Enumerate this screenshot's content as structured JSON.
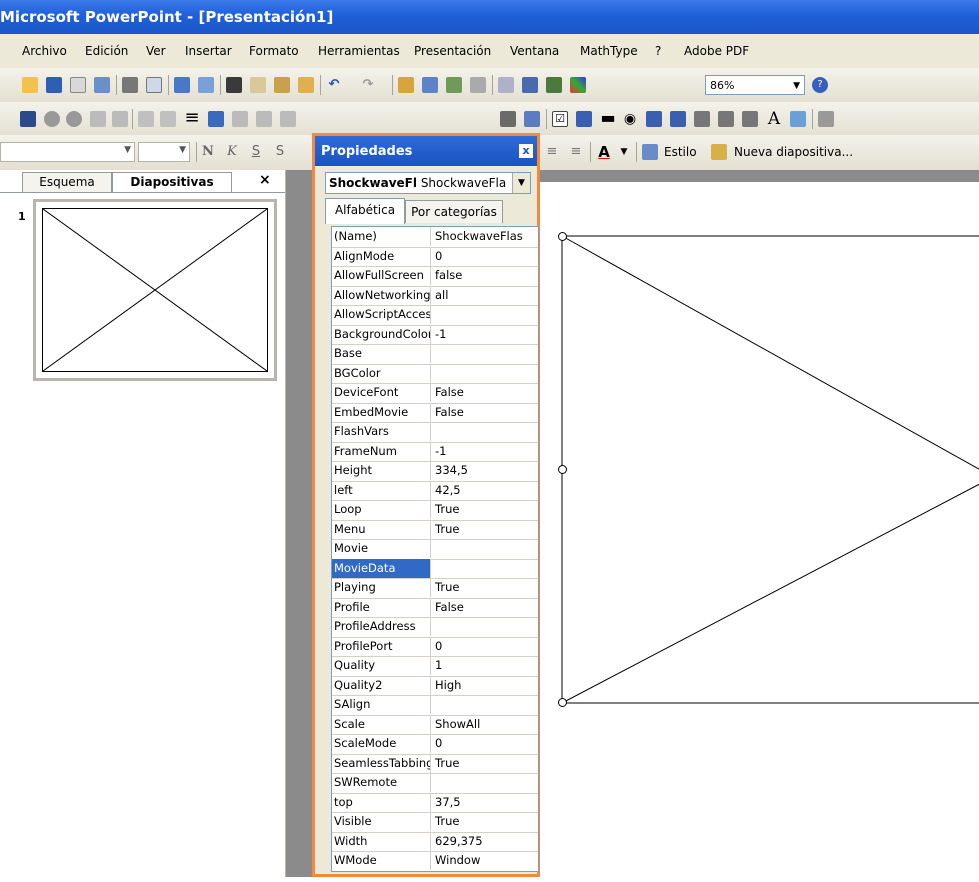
{
  "window": {
    "title": "Microsoft PowerPoint - [Presentación1]"
  },
  "menu": [
    "Archivo",
    "Edición",
    "Ver",
    "Insertar",
    "Formato",
    "Herramientas",
    "Presentación",
    "Ventana",
    "MathType",
    "?",
    "Adobe PDF"
  ],
  "toolbar": {
    "zoom": "86%",
    "font_bold": "N",
    "font_italic": "K",
    "font_underline": "S",
    "font_shadow": "S",
    "style_label": "Estilo",
    "new_slide_label": "Nueva diapositiva..."
  },
  "left_pane": {
    "tabs": [
      "Esquema",
      "Diapositivas"
    ],
    "close_glyph": "×",
    "slide_number": "1"
  },
  "properties": {
    "title": "Propiedades",
    "close_glyph": "x",
    "object_name": "ShockwaveFl",
    "object_type": "ShockwaveFla",
    "tabs": [
      "Alfabética",
      "Por categorías"
    ],
    "selected_property": "MovieData",
    "rows": [
      {
        "name": "(Name)",
        "value": "ShockwaveFlas"
      },
      {
        "name": "AlignMode",
        "value": "0"
      },
      {
        "name": "AllowFullScreen",
        "value": "false"
      },
      {
        "name": "AllowNetworking",
        "value": "all"
      },
      {
        "name": "AllowScriptAcces",
        "value": ""
      },
      {
        "name": "BackgroundColor",
        "value": "-1"
      },
      {
        "name": "Base",
        "value": ""
      },
      {
        "name": "BGColor",
        "value": ""
      },
      {
        "name": "DeviceFont",
        "value": "False"
      },
      {
        "name": "EmbedMovie",
        "value": "False"
      },
      {
        "name": "FlashVars",
        "value": ""
      },
      {
        "name": "FrameNum",
        "value": "-1"
      },
      {
        "name": "Height",
        "value": "334,5"
      },
      {
        "name": "left",
        "value": "42,5"
      },
      {
        "name": "Loop",
        "value": "True"
      },
      {
        "name": "Menu",
        "value": "True"
      },
      {
        "name": "Movie",
        "value": ""
      },
      {
        "name": "MovieData",
        "value": ""
      },
      {
        "name": "Playing",
        "value": "True"
      },
      {
        "name": "Profile",
        "value": "False"
      },
      {
        "name": "ProfileAddress",
        "value": ""
      },
      {
        "name": "ProfilePort",
        "value": "0"
      },
      {
        "name": "Quality",
        "value": "1"
      },
      {
        "name": "Quality2",
        "value": "High"
      },
      {
        "name": "SAlign",
        "value": ""
      },
      {
        "name": "Scale",
        "value": "ShowAll"
      },
      {
        "name": "ScaleMode",
        "value": "0"
      },
      {
        "name": "SeamlessTabbing",
        "value": "True"
      },
      {
        "name": "SWRemote",
        "value": ""
      },
      {
        "name": "top",
        "value": "37,5"
      },
      {
        "name": "Visible",
        "value": "True"
      },
      {
        "name": "Width",
        "value": "629,375"
      },
      {
        "name": "WMode",
        "value": "Window"
      }
    ]
  },
  "colors": {
    "title_bar": "#1f5fd8",
    "highlight_border": "#f28a3e",
    "selection": "#316ac5"
  }
}
